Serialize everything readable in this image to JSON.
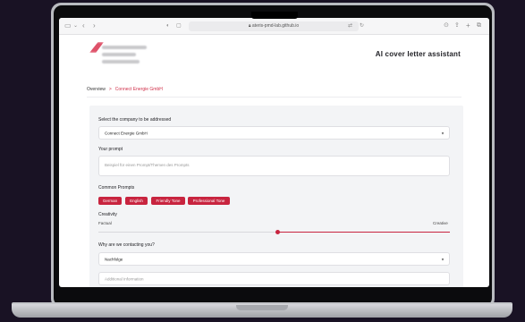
{
  "browser": {
    "url": "ateris-pmd-lab.github.io",
    "reader_icon": "reader-icon",
    "share_icon": "share-icon",
    "new_tab_icon": "plus-icon",
    "tabs_icon": "tabs-icon"
  },
  "header": {
    "logo_alt": "logo",
    "title": "AI cover letter assistant"
  },
  "breadcrumb": {
    "root": "Overview",
    "separator": ">",
    "current": "Connect Energie GmbH"
  },
  "form": {
    "company_label": "Select the company to be addressed",
    "company_value": "Connect Energie GmbH",
    "prompt_label": "Your prompt",
    "prompt_placeholder": "Beispiel für einen Prompt/Themen des Prompts",
    "common_prompts_label": "Common Prompts",
    "chips": [
      "German",
      "English",
      "Friendly Tone",
      "Professional Tone"
    ],
    "creativity_label": "Creativity",
    "creativity_min": "Factual",
    "creativity_max": "Creative",
    "creativity_value": 0.51,
    "reason_label": "Why are we contacting you?",
    "reason_value": "Nachfolge",
    "additional_placeholder": "Additional Information"
  },
  "colors": {
    "accent": "#c8243f",
    "background": "#191224"
  }
}
